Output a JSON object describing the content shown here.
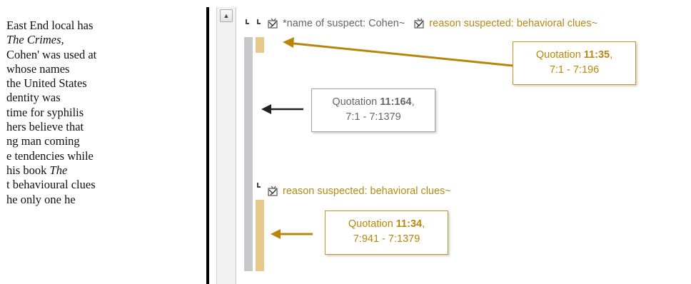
{
  "document": {
    "lines": [
      {
        "text": "East End local has"
      },
      {
        "text": "The Crimes,",
        "italic": true
      },
      {
        "text": "Cohen' was used at"
      },
      {
        "text": "whose names"
      },
      {
        "text": "the United States"
      },
      {
        "text": "dentity was"
      },
      {
        "text": "time for syphilis"
      },
      {
        "text": "hers believe that"
      },
      {
        "text": "ng man coming"
      },
      {
        "text": "e tendencies while"
      },
      {
        "text": "his book ",
        "italic_tail": "The"
      },
      {
        "text": "t behavioural clues"
      },
      {
        "text": "he only one he"
      }
    ]
  },
  "codes": [
    {
      "label": "*name of suspect: Cohen~",
      "color": "#666666",
      "icon": "code-icon"
    },
    {
      "label": "reason suspected: behavioral clues~",
      "color": "#b58914",
      "icon": "code-icon"
    },
    {
      "label": "reason suspected: behavioral clues~",
      "color": "#b58914",
      "icon": "code-icon"
    }
  ],
  "callouts": [
    {
      "prefix": "Quotation ",
      "id": "11:35",
      "suffix": ",",
      "range": "7:1 - 7:196",
      "style": "gold"
    },
    {
      "prefix": "Quotation ",
      "id": "11:164",
      "suffix": ",",
      "range": "7:1 - 7:1379",
      "style": "grey"
    },
    {
      "prefix": "Quotation ",
      "id": "11:34",
      "suffix": ",",
      "range": "7:941 - 7:1379",
      "style": "gold"
    }
  ],
  "scrollbar": {
    "up_icon": "scroll-up-arrow-icon"
  },
  "colors": {
    "gold": "#b58914",
    "gold_bar": "#e7c98c",
    "grey_bar": "#c8c8cc"
  }
}
